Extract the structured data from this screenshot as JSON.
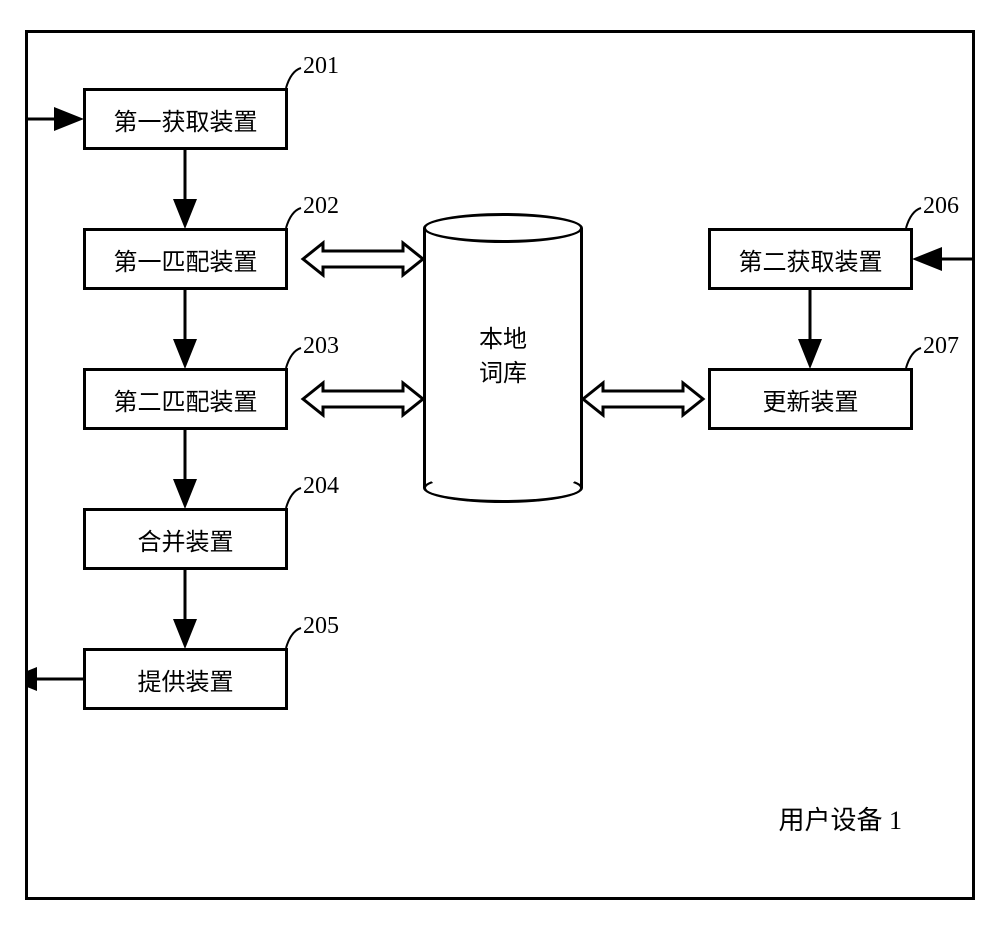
{
  "chart_data": {
    "type": "diagram",
    "container_label": "用户设备 1",
    "nodes": [
      {
        "id": "201",
        "label": "第一获取装置"
      },
      {
        "id": "202",
        "label": "第一匹配装置"
      },
      {
        "id": "203",
        "label": "第二匹配装置"
      },
      {
        "id": "204",
        "label": "合并装置"
      },
      {
        "id": "205",
        "label": "提供装置"
      },
      {
        "id": "206",
        "label": "第二获取装置"
      },
      {
        "id": "207",
        "label": "更新装置"
      },
      {
        "id": "db",
        "label": "本地词库"
      }
    ],
    "edges": [
      {
        "from": "external_in_left",
        "to": "201",
        "type": "arrow"
      },
      {
        "from": "201",
        "to": "202",
        "type": "arrow"
      },
      {
        "from": "202",
        "to": "203",
        "type": "arrow"
      },
      {
        "from": "203",
        "to": "204",
        "type": "arrow"
      },
      {
        "from": "204",
        "to": "205",
        "type": "arrow"
      },
      {
        "from": "205",
        "to": "external_out_left",
        "type": "arrow"
      },
      {
        "from": "external_in_right",
        "to": "206",
        "type": "arrow"
      },
      {
        "from": "206",
        "to": "207",
        "type": "arrow"
      },
      {
        "from": "202",
        "to": "db",
        "type": "bidirectional"
      },
      {
        "from": "203",
        "to": "db",
        "type": "bidirectional"
      },
      {
        "from": "207",
        "to": "db",
        "type": "bidirectional"
      }
    ]
  },
  "boxes": {
    "b201": {
      "num": "201",
      "label": "第一获取装置"
    },
    "b202": {
      "num": "202",
      "label": "第一匹配装置"
    },
    "b203": {
      "num": "203",
      "label": "第二匹配装置"
    },
    "b204": {
      "num": "204",
      "label": "合并装置"
    },
    "b205": {
      "num": "205",
      "label": "提供装置"
    },
    "b206": {
      "num": "206",
      "label": "第二获取装置"
    },
    "b207": {
      "num": "207",
      "label": "更新装置"
    }
  },
  "db": {
    "label": "本地\n词库"
  },
  "footer": "用户设备 1"
}
